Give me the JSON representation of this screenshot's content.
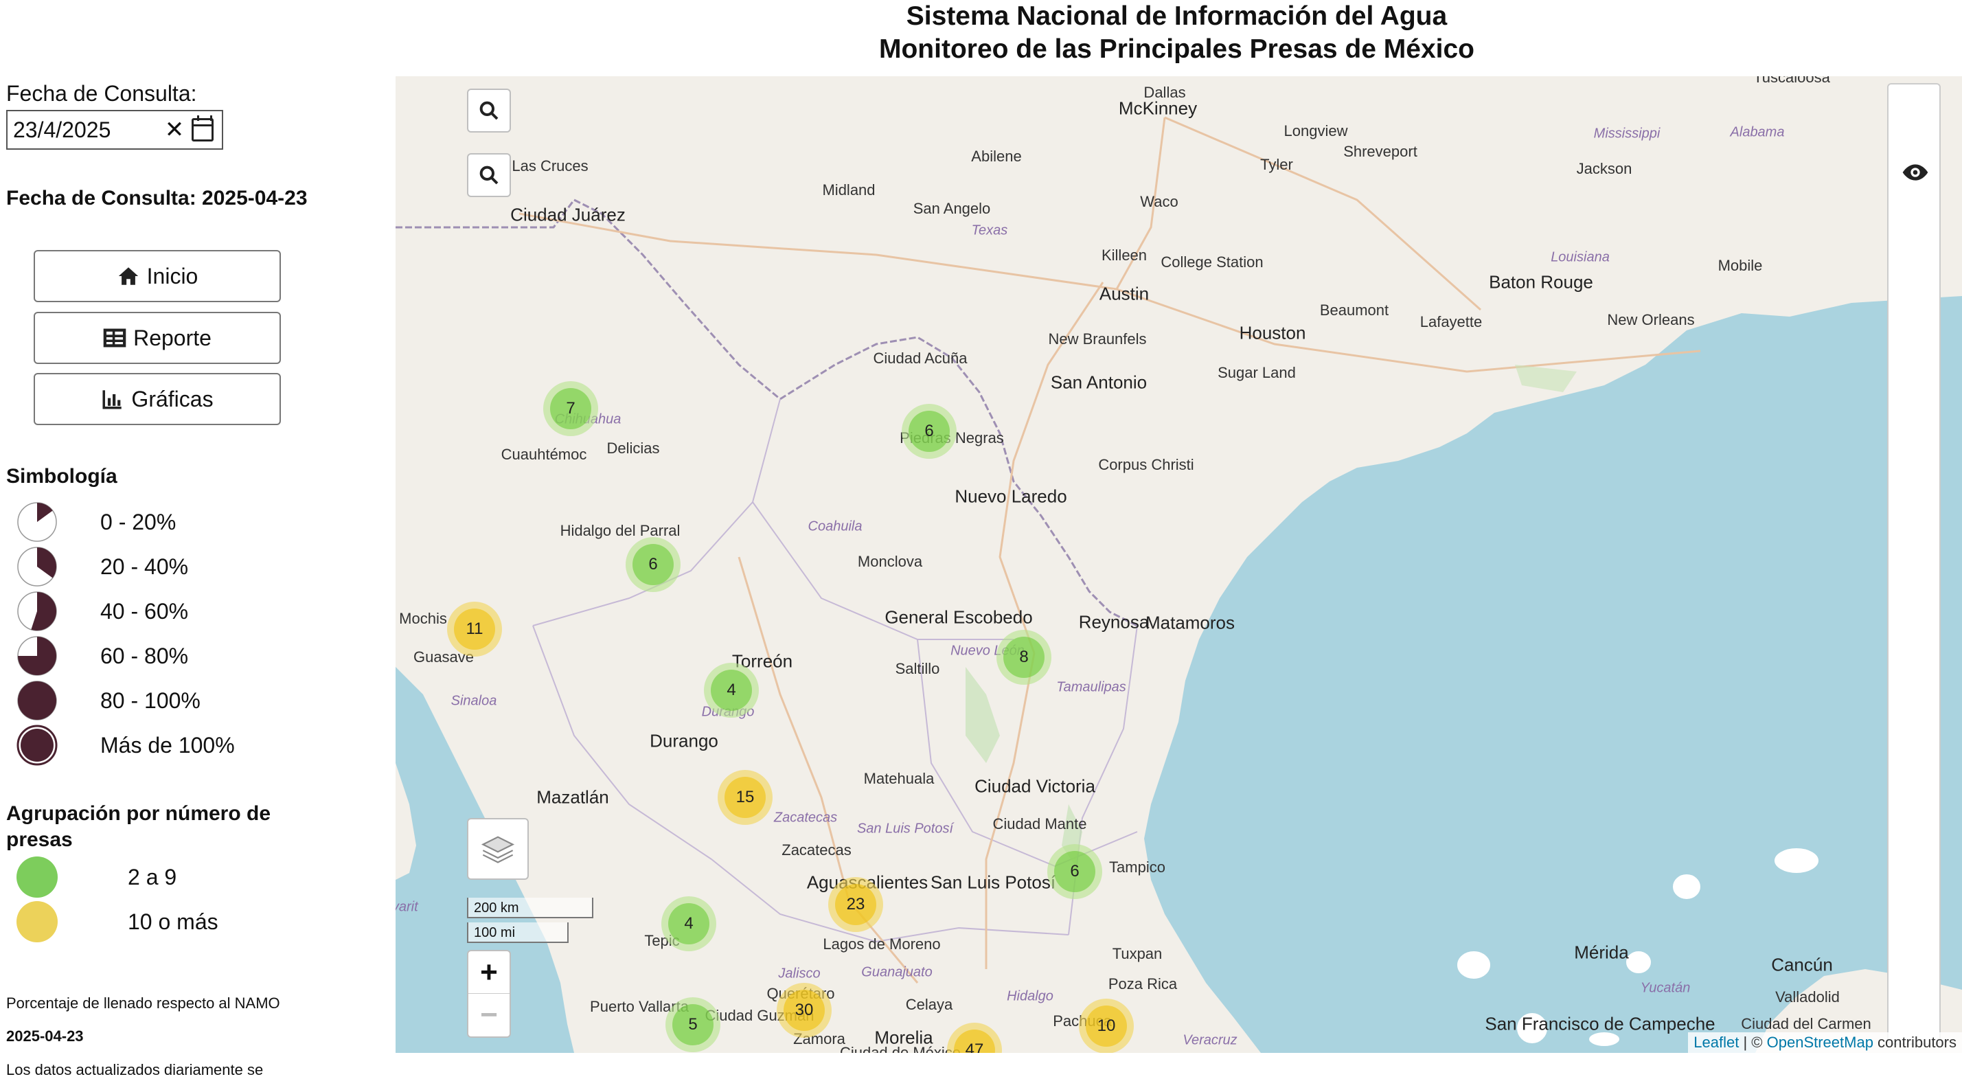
{
  "header": {
    "line1": "Sistema Nacional de Información del Agua",
    "line2": "Monitoreo de las Principales Presas de México"
  },
  "sidebar": {
    "date_label": "Fecha de Consulta:",
    "date_value": "23/4/2025",
    "consult_text": "Fecha de Consulta: 2025-04-23",
    "buttons": {
      "home": "Inicio",
      "report": "Reporte",
      "charts": "Gráficas"
    },
    "symbology_title": "Simbología",
    "symbology": [
      {
        "label": "0 - 20%",
        "fraction": 0.15
      },
      {
        "label": "20 - 40%",
        "fraction": 0.35
      },
      {
        "label": "40 - 60%",
        "fraction": 0.55
      },
      {
        "label": "60 - 80%",
        "fraction": 0.75
      },
      {
        "label": "80 - 100%",
        "fraction": 1.0
      },
      {
        "label": "Más de 100%",
        "fraction": 1.0
      }
    ],
    "grouping_title": "Agrupación por número de presas",
    "grouping": [
      {
        "label": "2 a 9",
        "color": "#7dcd5c"
      },
      {
        "label": "10 o más",
        "color": "#ecd25a"
      }
    ],
    "note": "Porcentaje de llenado respecto al NAMO",
    "note_date": "2025-04-23",
    "note_more": "Los datos actualizados diariamente se"
  },
  "colors": {
    "pie_fill": "#4a2230",
    "water": "#aad3df",
    "land": "#f2efe9",
    "green_cluster": "#6ecc39",
    "yellow_cluster": "#f0c20c"
  },
  "map": {
    "places": [
      {
        "name": "Dallas"
      },
      {
        "name": "McKinney"
      },
      {
        "name": "Longview"
      },
      {
        "name": "Shreveport"
      },
      {
        "name": "Tyler"
      },
      {
        "name": "Abilene"
      },
      {
        "name": "Midland"
      },
      {
        "name": "San Angelo"
      },
      {
        "name": "Waco"
      },
      {
        "name": "Killeen"
      },
      {
        "name": "College Station"
      },
      {
        "name": "Austin"
      },
      {
        "name": "Houston"
      },
      {
        "name": "Beaumont"
      },
      {
        "name": "Lafayette"
      },
      {
        "name": "Baton Rouge"
      },
      {
        "name": "New Orleans"
      },
      {
        "name": "Jackson"
      },
      {
        "name": "Mobile"
      },
      {
        "name": "Las Cruces"
      },
      {
        "name": "Ciudad Juárez"
      },
      {
        "name": "Ciudad Acuña"
      },
      {
        "name": "New Braunfels"
      },
      {
        "name": "San Antonio"
      },
      {
        "name": "Sugar Land"
      },
      {
        "name": "Cuauhtémoc"
      },
      {
        "name": "Delicias"
      },
      {
        "name": "Corpus Christi"
      },
      {
        "name": "Nuevo Laredo"
      },
      {
        "name": "Hidalgo del Parral"
      },
      {
        "name": "Monclova"
      },
      {
        "name": "Mochis"
      },
      {
        "name": "Guasave"
      },
      {
        "name": "General Escobedo"
      },
      {
        "name": "Reynosa"
      },
      {
        "name": "Matamoros"
      },
      {
        "name": "Torreón"
      },
      {
        "name": "Saltillo"
      },
      {
        "name": "Durango"
      },
      {
        "name": "Mazatlán"
      },
      {
        "name": "Matehuala"
      },
      {
        "name": "Ciudad Victoria"
      },
      {
        "name": "Ciudad Mante"
      },
      {
        "name": "Zacatecas"
      },
      {
        "name": "Aguascalientes"
      },
      {
        "name": "San Luis Potosí"
      },
      {
        "name": "Lagos de Moreno"
      },
      {
        "name": "Tuxpan"
      },
      {
        "name": "Poza Rica"
      },
      {
        "name": "Puerto Vallarta"
      },
      {
        "name": "Ciudad Guzmán"
      },
      {
        "name": "Zamora"
      },
      {
        "name": "Morelia"
      },
      {
        "name": "Celaya"
      },
      {
        "name": "Mérida"
      },
      {
        "name": "Cancún"
      },
      {
        "name": "Valladolid"
      },
      {
        "name": "San Francisco de Campeche"
      },
      {
        "name": "Ciudad del Carmen"
      },
      {
        "name": "Texas"
      },
      {
        "name": "Louisiana"
      },
      {
        "name": "Mississippi"
      },
      {
        "name": "Alabama"
      },
      {
        "name": "Tuscaloosa"
      },
      {
        "name": "Coahuila"
      },
      {
        "name": "Chihuahua"
      },
      {
        "name": "Sinaloa"
      },
      {
        "name": "Durango"
      },
      {
        "name": "Tamaulipas"
      },
      {
        "name": "Zacatecas"
      },
      {
        "name": "San Luis Potosí"
      },
      {
        "name": "Nayarit"
      },
      {
        "name": "Jalisco"
      },
      {
        "name": "Guanajuato"
      },
      {
        "name": "Hidalgo"
      },
      {
        "name": "Veracruz"
      },
      {
        "name": "Yucatán"
      },
      {
        "name": "Piedras Negras"
      },
      {
        "name": "Tepic"
      },
      {
        "name": "Querétaro"
      },
      {
        "name": "Pachuca"
      },
      {
        "name": "Nuevo León"
      },
      {
        "name": "Tampico"
      },
      {
        "name": "Ciudad de México"
      }
    ],
    "clusters": [
      {
        "count": "7",
        "group": "green"
      },
      {
        "count": "6",
        "group": "green"
      },
      {
        "count": "6",
        "group": "green"
      },
      {
        "count": "11",
        "group": "yellow"
      },
      {
        "count": "8",
        "group": "green"
      },
      {
        "count": "4",
        "group": "green"
      },
      {
        "count": "15",
        "group": "yellow"
      },
      {
        "count": "6",
        "group": "green"
      },
      {
        "count": "23",
        "group": "yellow"
      },
      {
        "count": "4",
        "group": "green"
      },
      {
        "count": "5",
        "group": "green"
      },
      {
        "count": "30",
        "group": "yellow"
      },
      {
        "count": "10",
        "group": "yellow"
      },
      {
        "count": "47",
        "group": "yellow"
      }
    ],
    "scale_km": "200 km",
    "scale_mi": "100 mi",
    "zoom_in": "+",
    "zoom_out": "−",
    "attribution_leaflet": "Leaflet",
    "attribution_sep": " | © ",
    "attribution_osm": "OpenStreetMap",
    "attribution_tail": " contributors"
  }
}
